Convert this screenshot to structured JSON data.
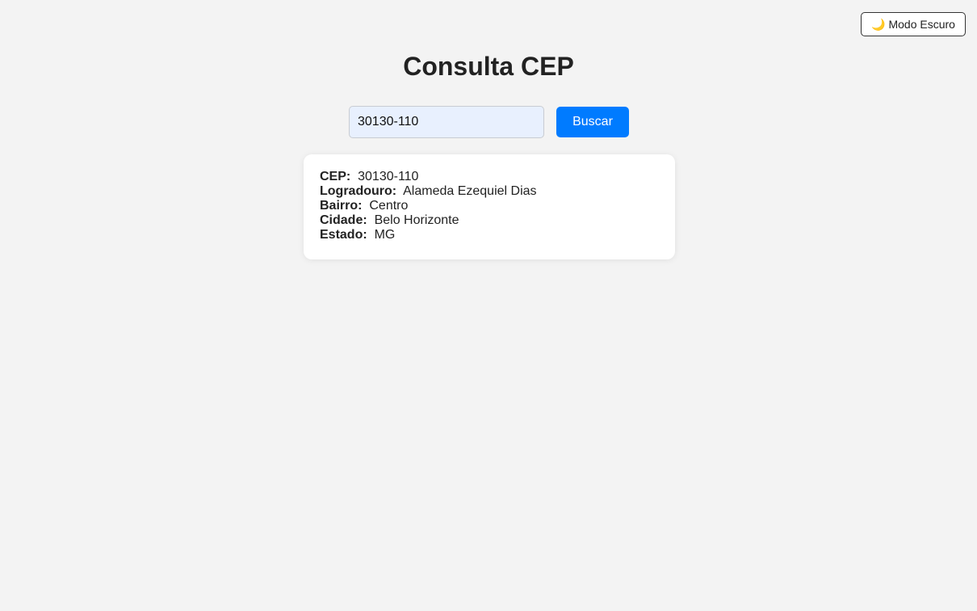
{
  "header": {
    "theme_toggle": {
      "icon": "moon-icon",
      "icon_glyph": "🌙",
      "label": "Modo Escuro"
    },
    "title": "Consulta CEP"
  },
  "search": {
    "input_value": "30130-110",
    "button_label": "Buscar"
  },
  "result": {
    "rows": [
      {
        "label": "CEP:",
        "value": "30130-110"
      },
      {
        "label": "Logradouro:",
        "value": "Alameda Ezequiel Dias"
      },
      {
        "label": "Bairro:",
        "value": "Centro"
      },
      {
        "label": "Cidade:",
        "value": "Belo Horizonte"
      },
      {
        "label": "Estado:",
        "value": "MG"
      }
    ]
  },
  "colors": {
    "background": "#f3f3f3",
    "primary_button": "#007bff",
    "input_autofill": "#e8f0fe",
    "card": "#ffffff"
  }
}
